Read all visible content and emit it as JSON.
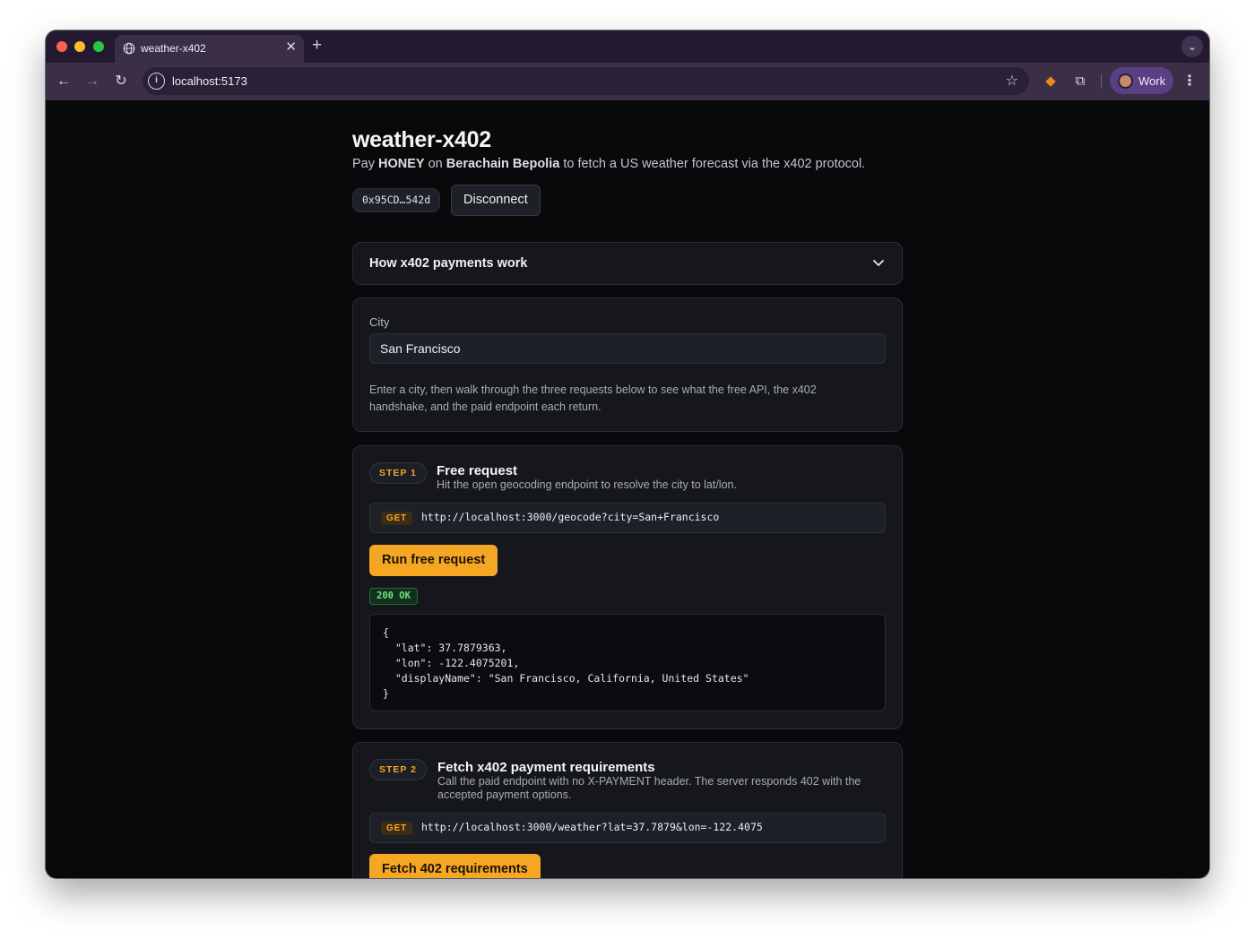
{
  "browser": {
    "tab_title": "weather-x402",
    "url": "localhost:5173",
    "profile_label": "Work"
  },
  "page": {
    "title": "weather-x402",
    "subtitle_pre": "Pay ",
    "subtitle_token": "HONEY",
    "subtitle_mid": " on ",
    "subtitle_chain": "Berachain Bepolia",
    "subtitle_post": " to fetch a US weather forecast via the x402 protocol.",
    "wallet_address": "0x95CD…542d",
    "disconnect_label": "Disconnect"
  },
  "how_it_works": {
    "label": "How x402 payments work"
  },
  "city": {
    "label": "City",
    "value": "San Francisco",
    "help": "Enter a city, then walk through the three requests below to see what the free API, the x402 handshake, and the paid endpoint each return."
  },
  "step1": {
    "badge": "STEP 1",
    "title": "Free request",
    "description": "Hit the open geocoding endpoint to resolve the city to lat/lon.",
    "method": "GET",
    "url": "http://localhost:3000/geocode?city=San+Francisco",
    "button": "Run free request",
    "status": "200 OK",
    "response": "{\n  \"lat\": 37.7879363,\n  \"lon\": -122.4075201,\n  \"displayName\": \"San Francisco, California, United States\"\n}"
  },
  "step2": {
    "badge": "STEP 2",
    "title": "Fetch x402 payment requirements",
    "description": "Call the paid endpoint with no X-PAYMENT header. The server responds 402 with the accepted payment options.",
    "method": "GET",
    "url": "http://localhost:3000/weather?lat=37.7879&lon=-122.4075",
    "button": "Fetch 402 requirements"
  },
  "colors": {
    "accent": "#f5a623",
    "background": "#09090b",
    "card": "#15171d",
    "success": "#6ee089"
  }
}
